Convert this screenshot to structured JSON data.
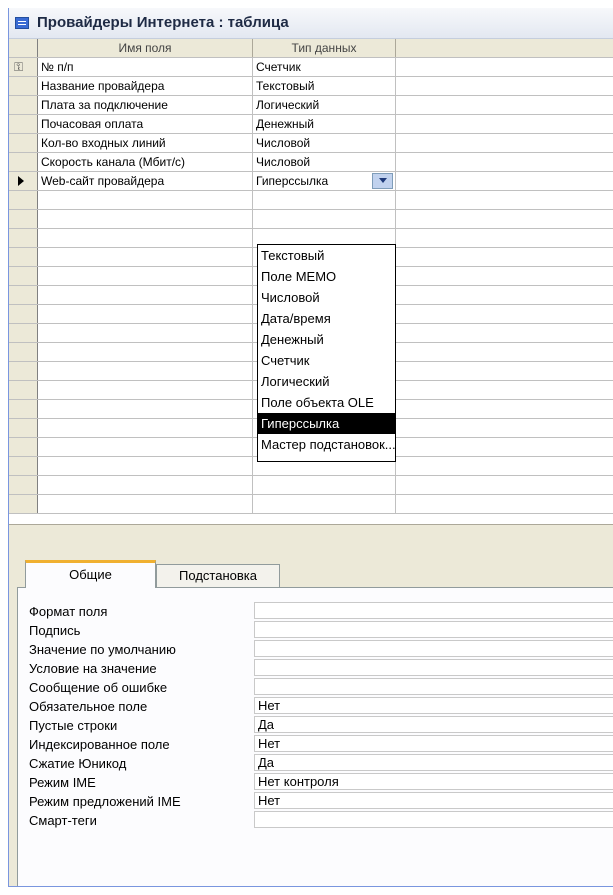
{
  "window": {
    "title": "Провайдеры Интернета : таблица",
    "icon": "table-icon"
  },
  "grid": {
    "headers": {
      "field_name": "Имя поля",
      "data_type": "Тип данных",
      "description": ""
    },
    "rows": [
      {
        "name": "№ п/п",
        "type": "Счетчик",
        "key": true
      },
      {
        "name": "Название провайдера",
        "type": "Текстовый"
      },
      {
        "name": "Плата за подключение",
        "type": "Логический"
      },
      {
        "name": "Почасовая оплата",
        "type": "Денежный"
      },
      {
        "name": "Кол-во входных линий",
        "type": "Числовой"
      },
      {
        "name": "Скорость канала (Мбит/с)",
        "type": "Числовой"
      },
      {
        "name": "Web-сайт провайдера",
        "type": "Гиперссылка",
        "current": true
      }
    ]
  },
  "dropdown": {
    "options": [
      "Текстовый",
      "Поле MEMO",
      "Числовой",
      "Дата/время",
      "Денежный",
      "Счетчик",
      "Логический",
      "Поле объекта OLE",
      "Гиперссылка",
      "Мастер подстановок..."
    ],
    "selected": "Гиперссылка"
  },
  "tabs": {
    "general": "Общие",
    "lookup": "Подстановка",
    "active": "general"
  },
  "properties": [
    {
      "label": "Формат поля",
      "value": ""
    },
    {
      "label": "Подпись",
      "value": ""
    },
    {
      "label": "Значение по умолчанию",
      "value": ""
    },
    {
      "label": "Условие на значение",
      "value": ""
    },
    {
      "label": "Сообщение об ошибке",
      "value": ""
    },
    {
      "label": "Обязательное поле",
      "value": "Нет"
    },
    {
      "label": "Пустые строки",
      "value": "Да"
    },
    {
      "label": "Индексированное поле",
      "value": "Нет"
    },
    {
      "label": "Сжатие Юникод",
      "value": "Да"
    },
    {
      "label": "Режим IME",
      "value": "Нет контроля"
    },
    {
      "label": "Режим предложений IME",
      "value": "Нет"
    },
    {
      "label": "Смарт-теги",
      "value": ""
    }
  ]
}
